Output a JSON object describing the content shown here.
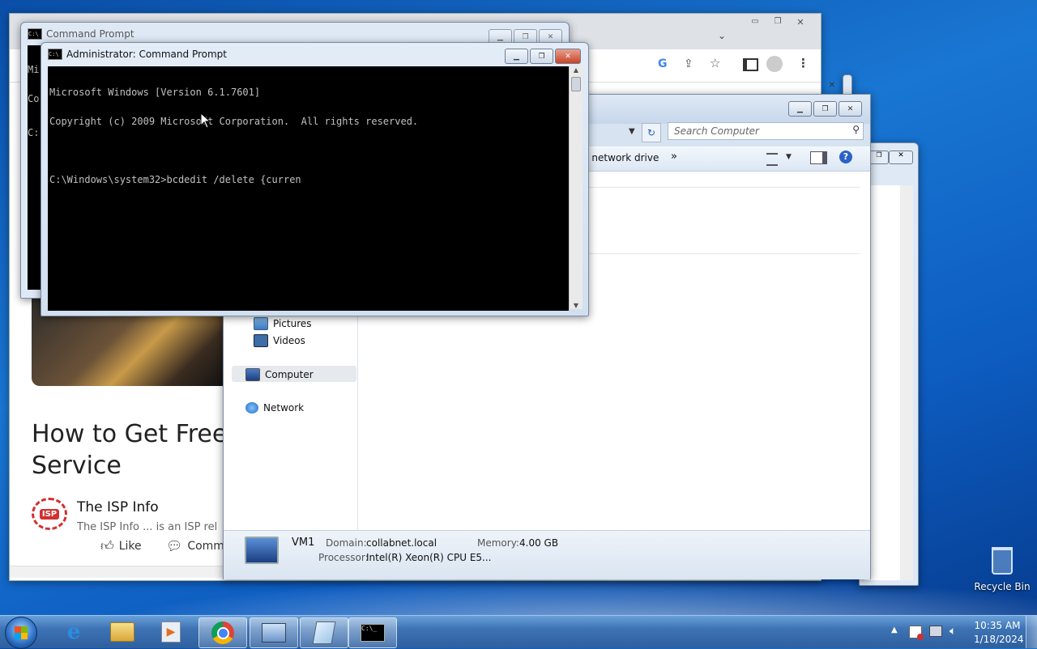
{
  "desktop": {
    "recycle_bin_label": "Recycle Bin"
  },
  "cmd_back": {
    "title": "Command Prompt",
    "visible_text": [
      "Mi",
      "Co",
      "C:"
    ]
  },
  "cmd_front": {
    "title": "Administrator: Command Prompt",
    "lines": [
      "Microsoft Windows [Version 6.1.7601]",
      "Copyright (c) 2009 Microsoft Corporation.  All rights reserved.",
      "",
      "C:\\Windows\\system32>bcdedit /delete {curren"
    ]
  },
  "browser": {
    "article_title": "How to Get Free\nService",
    "author": "The ISP Info",
    "author_blurb": "The ISP Info ... is an ISP rel",
    "logo_text": "ISP",
    "like_label": "Like",
    "comment_label": "Comme"
  },
  "explorer": {
    "search_placeholder": "Search Computer",
    "toolbar_map_drive": "p network drive",
    "toolbar_more": "»",
    "nav": {
      "pictures": "Pictures",
      "videos": "Videos",
      "computer": "Computer",
      "network": "Network"
    },
    "details": {
      "name": "VM1",
      "domain_label": "Domain:",
      "domain_value": "collabnet.local",
      "memory_label": "Memory:",
      "memory_value": "4.00 GB",
      "processor_label": "Processor:",
      "processor_value": "Intel(R) Xeon(R) CPU E5..."
    }
  },
  "taskbar": {
    "clock_time": "10:35 AM",
    "clock_date": "1/18/2024",
    "cmd_glyph": "C:\\_"
  },
  "colors": {
    "console_bg": "#000000",
    "console_fg": "#c0c0c0",
    "taskbar": "#3d73b4"
  }
}
